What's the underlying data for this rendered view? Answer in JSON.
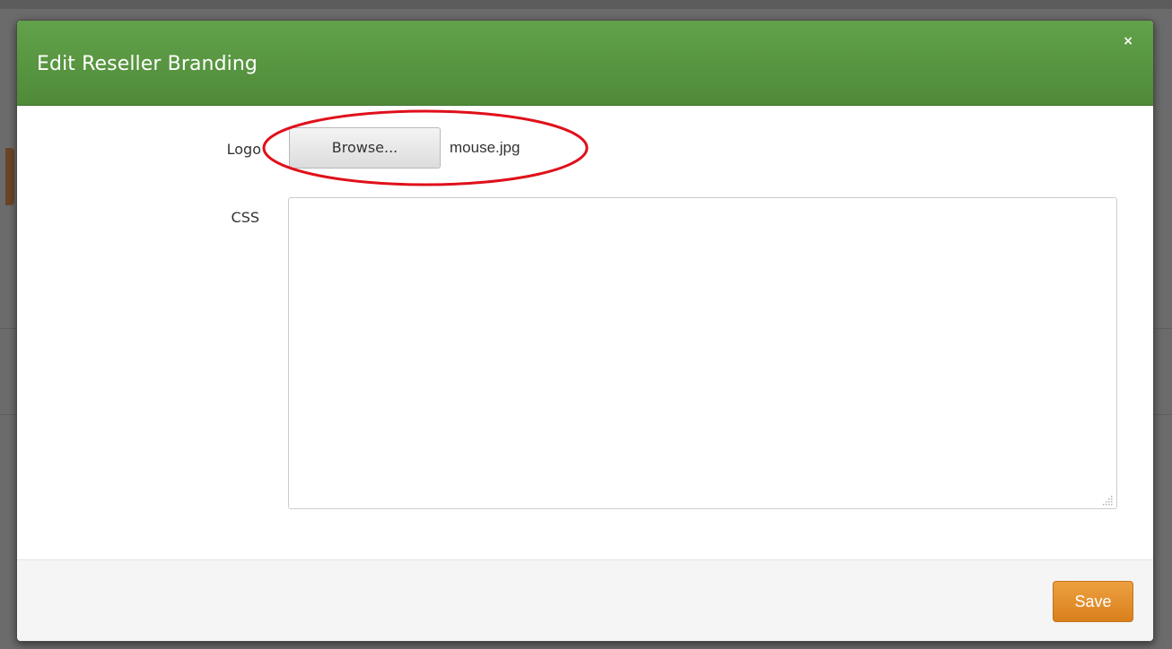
{
  "modal": {
    "title": "Edit Reseller Branding",
    "close_glyph": "×"
  },
  "form": {
    "logo": {
      "label": "Logo",
      "browse_label": "Browse...",
      "file_name": "mouse.jpg"
    },
    "css": {
      "label": "CSS",
      "value": ""
    }
  },
  "footer": {
    "save_label": "Save"
  },
  "colors": {
    "header": "#569a40",
    "save_button": "#e58f2a",
    "highlight_ellipse": "#e0101a"
  }
}
